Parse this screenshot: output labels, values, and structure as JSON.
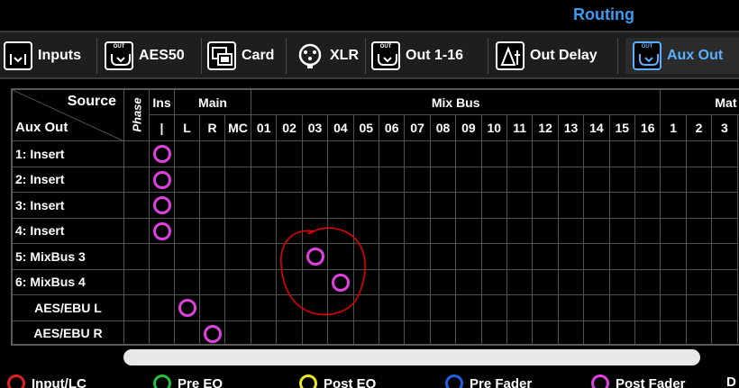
{
  "window": {
    "title": "Routing"
  },
  "tabs": [
    {
      "label": "Inputs",
      "icon": "input-in-icon",
      "mini": "",
      "active": false
    },
    {
      "label": "AES50",
      "icon": "output-out-icon",
      "mini": "OUT",
      "active": false
    },
    {
      "label": "Card",
      "icon": "card-icon",
      "mini": "",
      "active": false
    },
    {
      "label": "XLR",
      "icon": "xlr-connector-icon",
      "mini": "",
      "active": false
    },
    {
      "label": "Out 1-16",
      "icon": "output-out-icon",
      "mini": "OUT",
      "active": false
    },
    {
      "label": "Out Delay",
      "icon": "delta-t-icon",
      "mini": "",
      "active": false
    },
    {
      "label": "Aux Out",
      "icon": "output-out-icon",
      "mini": "OUT",
      "active": true
    }
  ],
  "grid": {
    "corner_source": "Source",
    "corner_target": "Aux Out",
    "phase_label": "Phase",
    "groups": {
      "ins": "Ins",
      "main": "Main",
      "mixbus": "Mix Bus",
      "matrix": "Mat"
    },
    "ins_sub": "|",
    "main_sub": [
      "L",
      "R",
      "MC"
    ],
    "mixbus_sub": [
      "01",
      "02",
      "03",
      "04",
      "05",
      "06",
      "07",
      "08",
      "09",
      "10",
      "11",
      "12",
      "13",
      "14",
      "15",
      "16"
    ],
    "matrix_sub": [
      "1",
      "2",
      "3"
    ],
    "rows": [
      "1: Insert",
      "2: Insert",
      "3: Insert",
      "4: Insert",
      "5: MixBus 3",
      "6: MixBus 4",
      "AES/EBU L",
      "AES/EBU R"
    ]
  },
  "routes": [
    {
      "row": 0,
      "source": "Ins"
    },
    {
      "row": 1,
      "source": "Ins"
    },
    {
      "row": 2,
      "source": "Ins"
    },
    {
      "row": 3,
      "source": "Ins"
    },
    {
      "row": 4,
      "source": "Mix Bus 03"
    },
    {
      "row": 5,
      "source": "Mix Bus 04"
    },
    {
      "row": 6,
      "source": "Main L"
    },
    {
      "row": 7,
      "source": "Main R"
    }
  ],
  "legend": [
    {
      "label": "Input/LC",
      "color": "#e02020"
    },
    {
      "label": "Pre EQ",
      "color": "#20c040"
    },
    {
      "label": "Post EQ",
      "color": "#e8e820"
    },
    {
      "label": "Pre Fader",
      "color": "#2060e0"
    },
    {
      "label": "Post Fader",
      "color": "#e040e0"
    },
    {
      "label": "D",
      "color": "#ffffff"
    }
  ],
  "colors": {
    "accent": "#3b9cf2",
    "route_dot": "#e040e0",
    "annotation": "#e00000"
  }
}
